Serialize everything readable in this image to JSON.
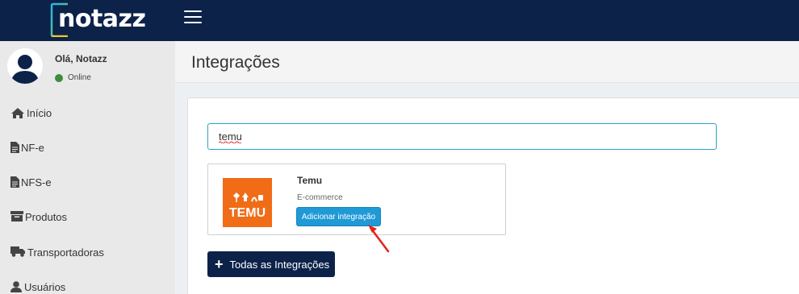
{
  "header": {
    "logo_text": "notazz"
  },
  "user": {
    "greeting": "Olá, Notazz",
    "status": "Online"
  },
  "sidebar": {
    "items": [
      {
        "label": "Início",
        "icon": "home-icon"
      },
      {
        "label": "NF-e",
        "icon": "file-icon"
      },
      {
        "label": "NFS-e",
        "icon": "file-icon"
      },
      {
        "label": "Produtos",
        "icon": "box-icon"
      },
      {
        "label": "Transportadoras",
        "icon": "truck-icon"
      },
      {
        "label": "Usuários",
        "icon": "user-icon"
      }
    ]
  },
  "page": {
    "title": "Integrações"
  },
  "search": {
    "value": "temu"
  },
  "integration": {
    "name": "Temu",
    "category": "E-commerce",
    "logo_text": "TEMU",
    "add_label": "Adicionar integração"
  },
  "all_button": {
    "label": "Todas as Integrações"
  },
  "colors": {
    "header_bg": "#0c2249",
    "sidebar_bg": "#e9e9e9",
    "accent": "#1f9ad6",
    "temu_orange": "#f06c17",
    "online": "#3c8d3c"
  }
}
